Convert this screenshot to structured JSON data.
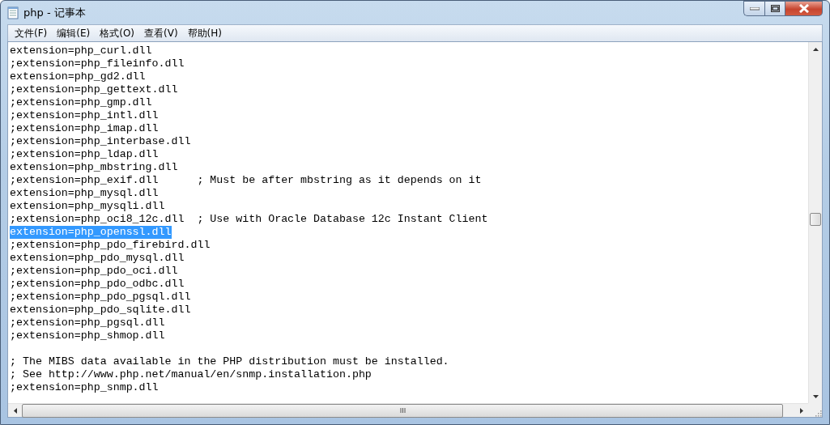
{
  "window": {
    "title": "php - 记事本"
  },
  "menu": [
    {
      "label": "文件(F)"
    },
    {
      "label": "编辑(E)"
    },
    {
      "label": "格式(O)"
    },
    {
      "label": "查看(V)"
    },
    {
      "label": "帮助(H)"
    }
  ],
  "lines": [
    {
      "kind": "text",
      "text": "extension=php_curl.dll",
      "selected": false
    },
    {
      "kind": "text",
      "text": ";extension=php_fileinfo.dll",
      "selected": false
    },
    {
      "kind": "text",
      "text": "extension=php_gd2.dll",
      "selected": false
    },
    {
      "kind": "text",
      "text": ";extension=php_gettext.dll",
      "selected": false
    },
    {
      "kind": "text",
      "text": ";extension=php_gmp.dll",
      "selected": false
    },
    {
      "kind": "text",
      "text": ";extension=php_intl.dll",
      "selected": false
    },
    {
      "kind": "text",
      "text": ";extension=php_imap.dll",
      "selected": false
    },
    {
      "kind": "text",
      "text": ";extension=php_interbase.dll",
      "selected": false
    },
    {
      "kind": "text",
      "text": ";extension=php_ldap.dll",
      "selected": false
    },
    {
      "kind": "text",
      "text": "extension=php_mbstring.dll",
      "selected": false
    },
    {
      "kind": "text",
      "text": ";extension=php_exif.dll      ; Must be after mbstring as it depends on it",
      "selected": false
    },
    {
      "kind": "text",
      "text": "extension=php_mysql.dll",
      "selected": false
    },
    {
      "kind": "text",
      "text": "extension=php_mysqli.dll",
      "selected": false
    },
    {
      "kind": "text",
      "text": ";extension=php_oci8_12c.dll  ; Use with Oracle Database 12c Instant Client",
      "selected": false
    },
    {
      "kind": "text",
      "text": "extension=php_openssl.dll",
      "selected": true
    },
    {
      "kind": "text",
      "text": ";extension=php_pdo_firebird.dll",
      "selected": false
    },
    {
      "kind": "text",
      "text": "extension=php_pdo_mysql.dll",
      "selected": false
    },
    {
      "kind": "text",
      "text": ";extension=php_pdo_oci.dll",
      "selected": false
    },
    {
      "kind": "text",
      "text": ";extension=php_pdo_odbc.dll",
      "selected": false
    },
    {
      "kind": "text",
      "text": ";extension=php_pdo_pgsql.dll",
      "selected": false
    },
    {
      "kind": "text",
      "text": "extension=php_pdo_sqlite.dll",
      "selected": false
    },
    {
      "kind": "text",
      "text": ";extension=php_pgsql.dll",
      "selected": false
    },
    {
      "kind": "text",
      "text": ";extension=php_shmop.dll",
      "selected": false
    },
    {
      "kind": "blank"
    },
    {
      "kind": "text",
      "text": "; The MIBS data available in the PHP distribution must be installed.",
      "selected": false
    },
    {
      "kind": "text",
      "text": "; See http://www.php.net/manual/en/snmp.installation.php",
      "selected": false
    },
    {
      "kind": "text",
      "text": ";extension=php_snmp.dll",
      "selected": false
    }
  ]
}
